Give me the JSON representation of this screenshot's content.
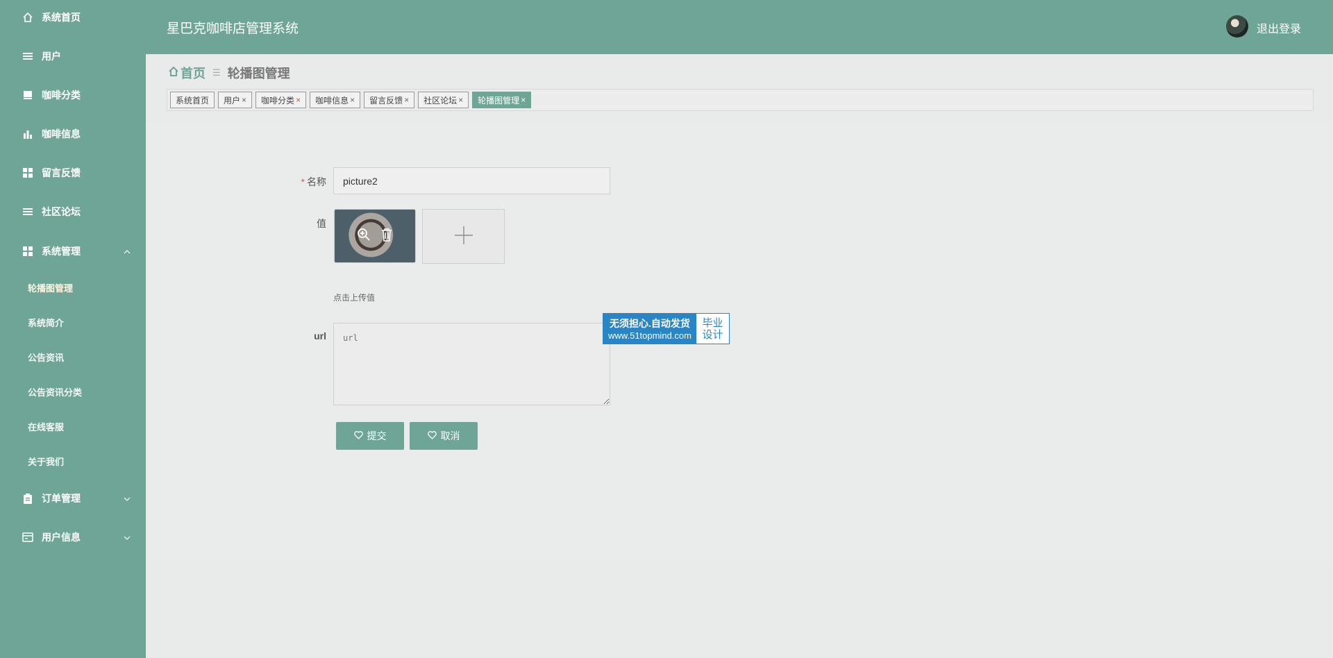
{
  "app": {
    "title": "星巴克咖啡店管理系统",
    "logout": "退出登录"
  },
  "sidebar": {
    "items": [
      {
        "label": "系统首页",
        "icon": "home-icon"
      },
      {
        "label": "用户",
        "icon": "list-icon"
      },
      {
        "label": "咖啡分类",
        "icon": "box-icon"
      },
      {
        "label": "咖啡信息",
        "icon": "bar-chart-icon"
      },
      {
        "label": "留言反馈",
        "icon": "grid-icon"
      },
      {
        "label": "社区论坛",
        "icon": "list-icon"
      },
      {
        "label": "系统管理",
        "icon": "grid-icon",
        "expanded": true
      },
      {
        "label": "订单管理",
        "icon": "clipboard-icon",
        "expanded": false
      },
      {
        "label": "用户信息",
        "icon": "card-icon",
        "expanded": false
      }
    ],
    "sub_items": [
      "轮播图管理",
      "系统简介",
      "公告资讯",
      "公告资讯分类",
      "在线客服",
      "关于我们"
    ],
    "active_sub": "轮播图管理"
  },
  "breadcrumb": {
    "home": "首页",
    "current": "轮播图管理"
  },
  "tabs": [
    {
      "label": "系统首页",
      "closable": false
    },
    {
      "label": "用户",
      "closable": true
    },
    {
      "label": "咖啡分类",
      "closable": true
    },
    {
      "label": "咖啡信息",
      "closable": true
    },
    {
      "label": "留言反馈",
      "closable": true
    },
    {
      "label": "社区论坛",
      "closable": true
    },
    {
      "label": "轮播图管理",
      "closable": true,
      "active": true
    }
  ],
  "form": {
    "name_label": "名称",
    "name_value": "picture2",
    "value_label": "值",
    "upload_hint": "点击上传值",
    "url_label": "url",
    "url_placeholder": "url",
    "submit": "提交",
    "cancel": "取消"
  },
  "watermark": {
    "line1": "无须担心.自动发货",
    "line2": "www.51topmind.com",
    "right1": "毕业",
    "right2": "设计"
  },
  "colors": {
    "primary": "#6ea597",
    "background": "#e9eaea",
    "required": "#e05c4b",
    "watermark_blue": "#2a85c5"
  }
}
